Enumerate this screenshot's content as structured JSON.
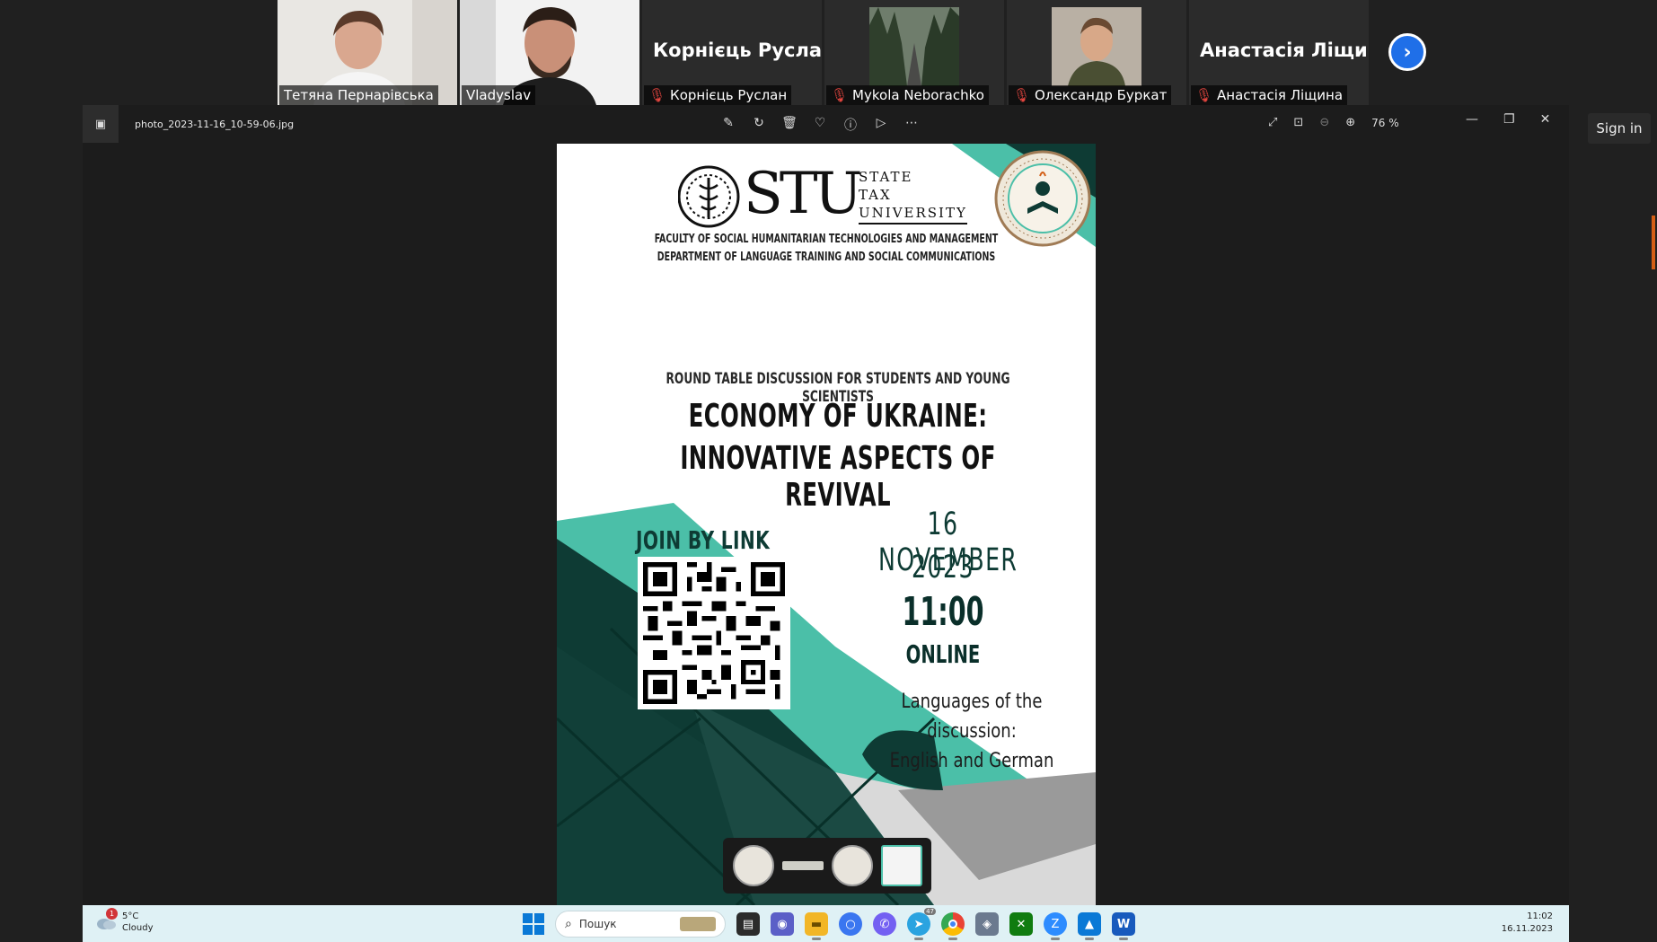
{
  "participants": [
    {
      "name": "Тетяна Пернарівська",
      "muted": false,
      "type": "video"
    },
    {
      "name": "Vladyslav",
      "muted": false,
      "type": "video",
      "active": true
    },
    {
      "name": "Корнієць Руслан",
      "display_name": "Корнієць Руслан",
      "muted": true,
      "type": "name"
    },
    {
      "name": "Mykola Neborachko",
      "muted": true,
      "type": "image"
    },
    {
      "name": "Олександр Буркат",
      "muted": true,
      "type": "image"
    },
    {
      "name": "Анастасія Ліщина",
      "display_name": "Анастасія Ліщи...",
      "muted": true,
      "type": "name"
    }
  ],
  "icons": {
    "next": "chevron-right-icon",
    "muted": "mic-off-icon"
  },
  "viewer": {
    "file_name": "photo_2023-11-16_10-59-06.jpg",
    "zoom": "76 %"
  },
  "signin_label": "Sign in",
  "poster": {
    "logo_letters": "STU",
    "logo_lines": [
      "STATE",
      "TAX",
      "UNIVERSITY"
    ],
    "faculty_line1": "FACULTY OF SOCIAL HUMANITARIAN TECHNOLOGIES AND MANAGEMENT",
    "faculty_line2": "DEPARTMENT OF LANGUAGE TRAINING AND SOCIAL COMMUNICATIONS",
    "round_table": "ROUND TABLE DISCUSSION FOR STUDENTS AND YOUNG SCIENTISTS",
    "title_line1": "ECONOMY OF UKRAINE:",
    "title_line2": "INNOVATIVE ASPECTS OF REVIVAL",
    "join": "JOIN BY LINK",
    "date_line1": "16 NOVEMBER",
    "date_line2": "2023",
    "time": "11:00",
    "mode": "ONLINE",
    "languages_label": "Languages of the discussion:",
    "languages": "English and German",
    "accent_color": "#4bbfa8",
    "dark_color": "#0e3b34"
  },
  "taskbar": {
    "weather_temp": "5°C",
    "weather_desc": "Cloudy",
    "notification_count": "1",
    "search_placeholder": "Пошук",
    "time": "11:02",
    "date": "16.11.2023",
    "telegram_badge": "47"
  }
}
